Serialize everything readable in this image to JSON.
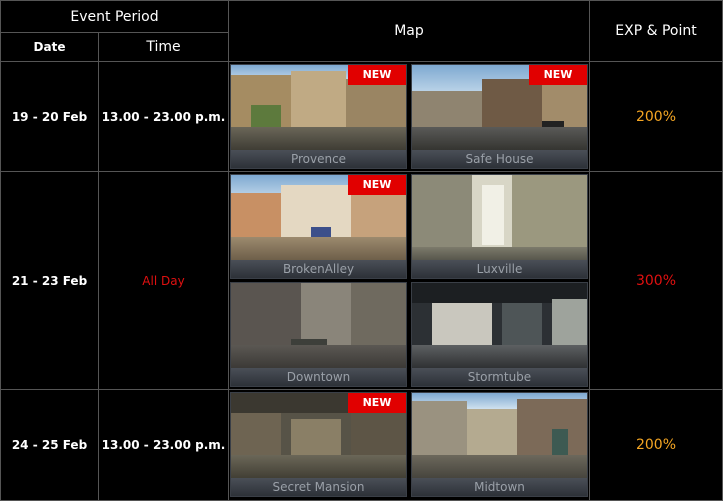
{
  "header": {
    "event_period": "Event Period",
    "date": "Date",
    "time": "Time",
    "map": "Map",
    "exp_point": "EXP & Point"
  },
  "colors": {
    "orange": "#f5a623",
    "red": "#e01010",
    "new_badge": "#e10000"
  },
  "rows": [
    {
      "date": "19 - 20 Feb",
      "time": "13.00 - 23.00 p.m.",
      "percent": "200%",
      "maps": [
        {
          "name": "Provence",
          "badge": "NEW"
        },
        {
          "name": "Safe House",
          "badge": "NEW"
        }
      ]
    },
    {
      "date": "21 - 23 Feb",
      "time": "All Day",
      "percent": "300%",
      "maps": [
        {
          "name": "BrokenAlley",
          "badge": "NEW"
        },
        {
          "name": "Luxville",
          "badge": ""
        },
        {
          "name": "Downtown",
          "badge": ""
        },
        {
          "name": "Stormtube",
          "badge": ""
        }
      ]
    },
    {
      "date": "24 - 25 Feb",
      "time": "13.00 - 23.00 p.m.",
      "percent": "200%",
      "maps": [
        {
          "name": "Secret Mansion",
          "badge": "NEW"
        },
        {
          "name": "Midtown",
          "badge": ""
        }
      ]
    }
  ]
}
